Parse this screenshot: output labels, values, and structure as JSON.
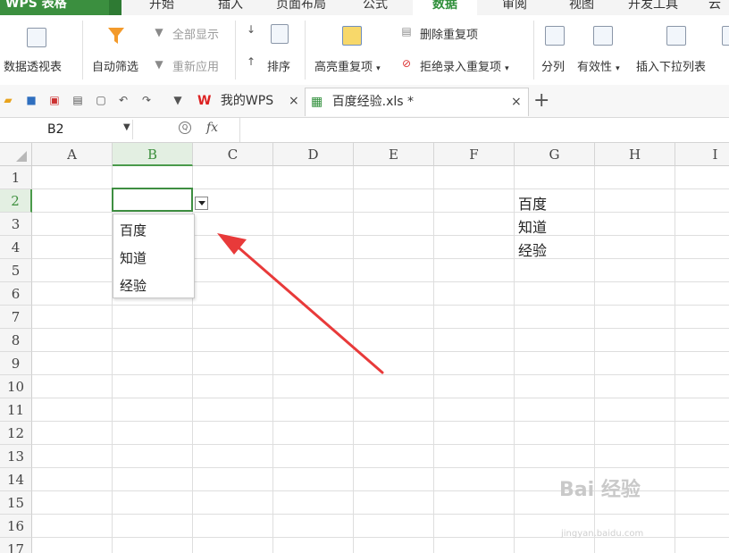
{
  "app": {
    "name": "WPS 表格"
  },
  "menu_tabs": [
    "开始",
    "插入",
    "页面布局",
    "公式",
    "数据",
    "审阅",
    "视图",
    "开发工具",
    "云服"
  ],
  "active_menu_tab": "数据",
  "ribbon": {
    "pivot_table": "数据透视表",
    "auto_filter": "自动筛选",
    "show_all": "全部显示",
    "reapply": "重新应用",
    "sort": "排序",
    "highlight_duplicates": "高亮重复项",
    "remove_duplicates": "删除重复项",
    "reject_duplicates": "拒绝录入重复项",
    "split_column": "分列",
    "validity": "有效性",
    "insert_dropdown": "插入下拉列表"
  },
  "doc_tabs": [
    {
      "label": "我的WPS"
    },
    {
      "label": "百度经验.xls *"
    }
  ],
  "formula_bar": {
    "cell_ref": "B2",
    "fx": "fx",
    "value": ""
  },
  "columns": [
    "A",
    "B",
    "C",
    "D",
    "E",
    "F",
    "G",
    "H",
    "I"
  ],
  "selected_column": "B",
  "rows": [
    "1",
    "2",
    "3",
    "4",
    "5",
    "6",
    "7",
    "8",
    "9",
    "10",
    "11",
    "12",
    "13",
    "14",
    "15",
    "16",
    "17"
  ],
  "selected_row": "2",
  "column_g_values": [
    "百度",
    "知道",
    "经验"
  ],
  "dropdown_options": [
    "百度",
    "知道",
    "经验"
  ],
  "watermark": {
    "brand": "Bai 经验",
    "url": "jingyan.baidu.com"
  },
  "colors": {
    "accent_green": "#3b8f3f",
    "arrow_red": "#e83a3a"
  }
}
